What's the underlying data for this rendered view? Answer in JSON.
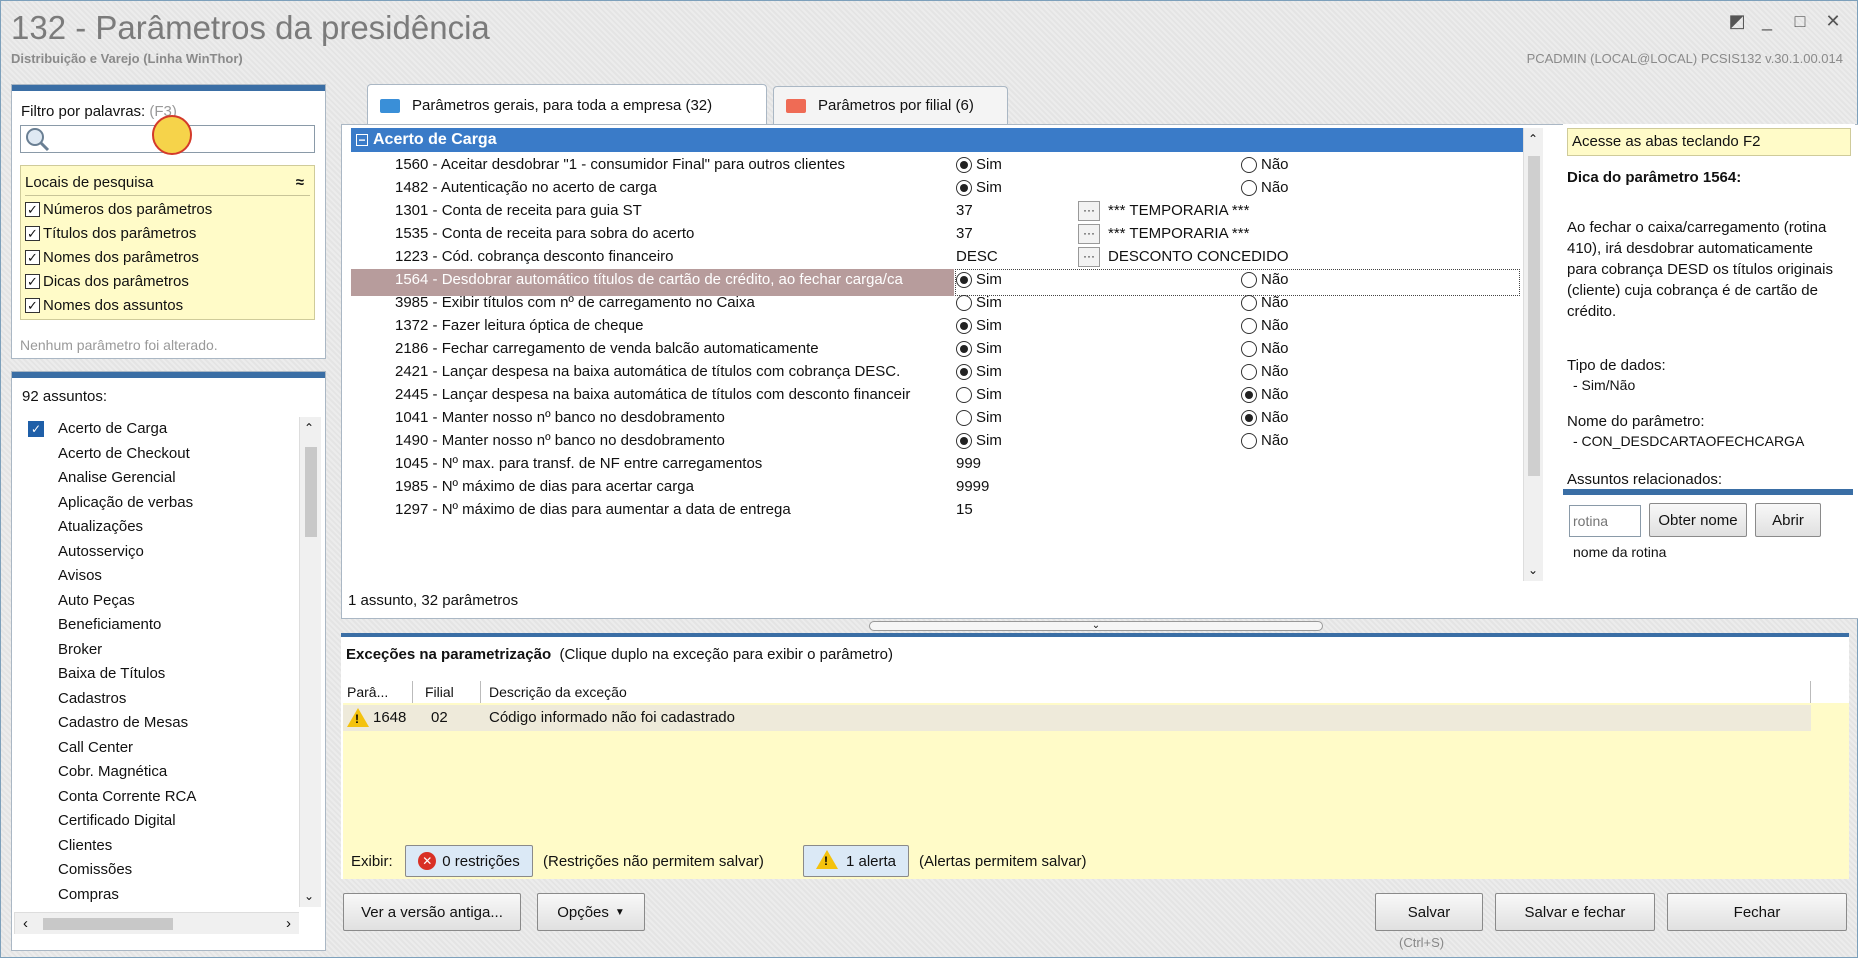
{
  "window": {
    "title": "132 - Parâmetros da presidência",
    "subtitle": "Distribuição e Varejo (Linha WinThor)",
    "user_info": "PCADMIN (LOCAL@LOCAL)   PCSIS132  v.30.1.00.014",
    "restore_glyph": "◩",
    "minimize_glyph": "_",
    "maximize_glyph": "□",
    "close_glyph": "✕"
  },
  "filter": {
    "label": "Filtro por palavras:",
    "shortcut": "(F3)",
    "search_value": "",
    "locations_title": "Locais de pesquisa",
    "collapse_glyph": "≈",
    "locations": [
      {
        "label": "Números dos parâmetros",
        "checked": true
      },
      {
        "label": "Títulos dos parâmetros",
        "checked": true
      },
      {
        "label": "Nomes dos parâmetros",
        "checked": true
      },
      {
        "label": "Dicas dos parâmetros",
        "checked": true
      },
      {
        "label": "Nomes dos assuntos",
        "checked": true
      }
    ],
    "status": "Nenhum parâmetro foi alterado."
  },
  "subjects": {
    "count_label": "92 assuntos:",
    "items": [
      "Acerto de Carga",
      "Acerto de Checkout",
      "Analise Gerencial",
      "Aplicação de verbas",
      "Atualizações",
      "Autosserviço",
      "Avisos",
      "Auto Peças",
      "Beneficiamento",
      "Broker",
      "Baixa de Títulos",
      "Cadastros",
      "Cadastro de Mesas",
      "Call Center",
      "Cobr. Magnética",
      "Conta Corrente RCA",
      "Certificado Digital",
      "Clientes",
      "Comissões",
      "Compras"
    ],
    "selected_index": 0
  },
  "tabs": [
    {
      "label": "Parâmetros gerais, para toda a empresa (32)",
      "active": true,
      "color": "#3a8fd8"
    },
    {
      "label": "Parâmetros por filial (6)",
      "active": false,
      "color": "#ef6b55"
    }
  ],
  "grid": {
    "group_title": "Acerto de Carga",
    "yes_label": "Sim",
    "no_label": "Não",
    "rows": [
      {
        "name": "1560 - Aceitar desdobrar \"1 - consumidor Final\" para outros clientes",
        "type": "radio",
        "value": "Sim"
      },
      {
        "name": "1482 - Autenticação no acerto de carga",
        "type": "radio",
        "value": "Sim"
      },
      {
        "name": "1301 - Conta de receita para guia ST",
        "type": "lookup",
        "value": "37",
        "desc": "*** TEMPORARIA ***"
      },
      {
        "name": "1535 - Conta de receita para sobra do acerto",
        "type": "lookup",
        "value": "37",
        "desc": "*** TEMPORARIA ***"
      },
      {
        "name": "1223 - Cód. cobrança desconto financeiro",
        "type": "lookup",
        "value": "DESC",
        "desc": "DESCONTO CONCEDIDO"
      },
      {
        "name": "1564 - Desdobrar automático títulos de cartão de crédito, ao fechar carga/ca",
        "type": "radio",
        "value": "Sim",
        "highlight": true
      },
      {
        "name": "3985 - Exibir títulos com nº de carregamento no Caixa",
        "type": "radio",
        "value": "none"
      },
      {
        "name": "1372 - Fazer leitura óptica de cheque",
        "type": "radio",
        "value": "Sim"
      },
      {
        "name": "2186 - Fechar carregamento de venda balcão automaticamente",
        "type": "radio",
        "value": "Sim"
      },
      {
        "name": "2421 - Lançar despesa na baixa automática de títulos com cobrança DESC.",
        "type": "radio",
        "value": "Sim"
      },
      {
        "name": "2445 - Lançar despesa na baixa automática de títulos com desconto financeir",
        "type": "radio",
        "value": "Não"
      },
      {
        "name": "1041 - Manter nosso nº banco no desdobramento",
        "type": "radio",
        "value": "Não"
      },
      {
        "name": "1490 - Manter nosso nº banco no desdobramento",
        "type": "radio",
        "value": "Sim"
      },
      {
        "name": "1045 - Nº max. para transf. de NF entre carregamentos",
        "type": "text",
        "value": "999"
      },
      {
        "name": "1985 - Nº máximo de dias para acertar carga",
        "type": "text",
        "value": "9999"
      },
      {
        "name": "1297 - Nº máximo de dias para aumentar a data de entrega",
        "type": "text",
        "value": "15"
      }
    ],
    "footer": "1 assunto, 32 parâmetros"
  },
  "help": {
    "hint": "Acesse as abas teclando F2",
    "title": "Dica do parâmetro 1564:",
    "body": "Ao fechar o caixa/carregamento (rotina 410), irá desdobrar automaticamente para cobrança DESD os títulos originais (cliente) cuja cobrança é de cartão de crédito.",
    "type_label": "Tipo de dados:",
    "type_value": "- Sim/Não",
    "param_name_label": "Nome do parâmetro:",
    "param_name_value": "- CON_DESDCARTAOFECHCARGA",
    "related_label": "Assuntos relacionados:",
    "routine_placeholder": "rotina",
    "get_name_button": "Obter nome",
    "open_button": "Abrir",
    "routine_name_label": "nome da rotina"
  },
  "exceptions": {
    "title": "Exceções na parametrização",
    "subtitle": "(Clique duplo na exceção para exibir o parâmetro)",
    "columns": [
      "Parâ...",
      "Filial",
      "Descrição da exceção"
    ],
    "rows": [
      {
        "param": "1648",
        "filial": "02",
        "desc": "Código informado não foi cadastrado"
      }
    ],
    "show_label": "Exibir:",
    "restrictions_button": "0 restrições",
    "restrictions_note": "(Restrições não permitem salvar)",
    "alerts_button": "1 alerta",
    "alerts_note": "(Alertas permitem salvar)"
  },
  "footer": {
    "old_version_button": "Ver a versão antiga...",
    "options_button": "Opções",
    "save_button": "Salvar",
    "save_shortcut": "(Ctrl+S)",
    "save_close_button": "Salvar e fechar",
    "close_button": "Fechar"
  }
}
